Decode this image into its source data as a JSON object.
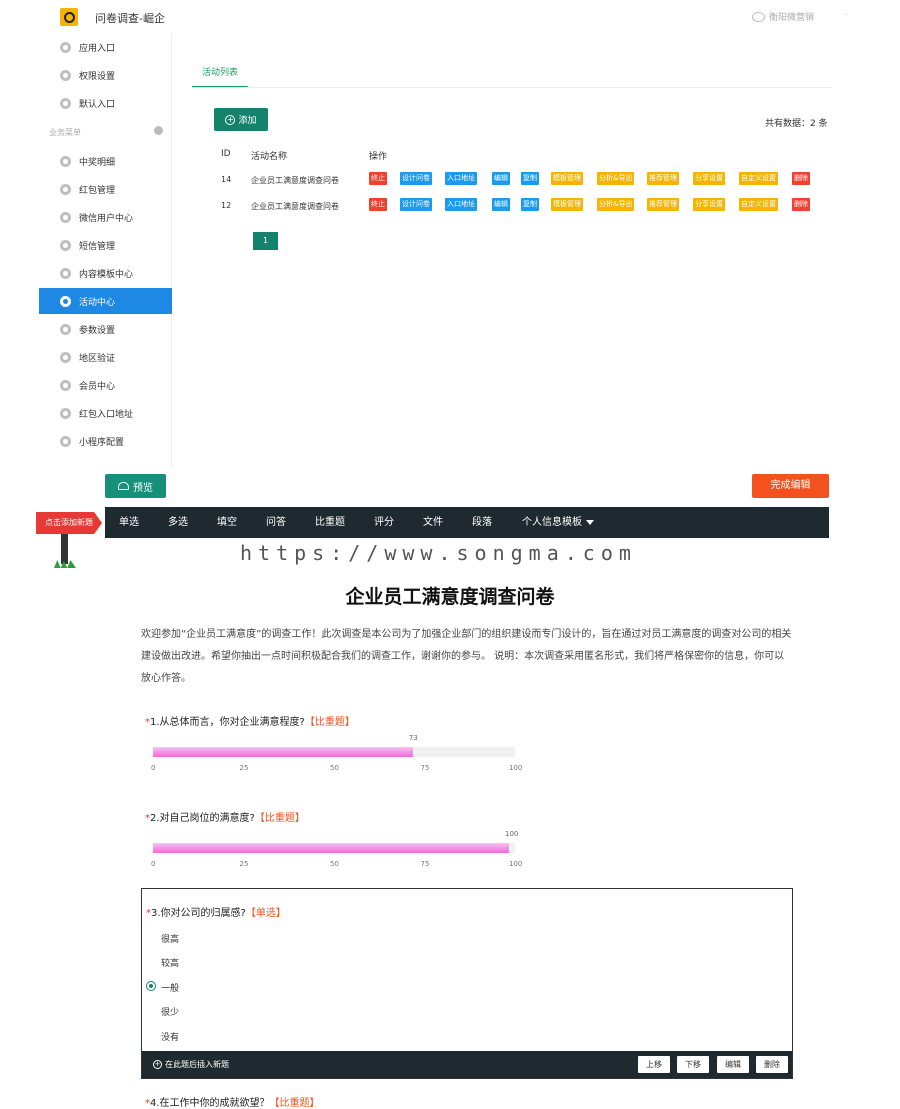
{
  "admin": {
    "app_title": "问卷调查-崛企",
    "account_name": "衡阳微营销",
    "sidebar": {
      "top_items": [
        {
          "label": "应用入口"
        },
        {
          "label": "权限设置"
        },
        {
          "label": "默认入口"
        }
      ],
      "section_label": "业务菜单",
      "items": [
        {
          "label": "中奖明细"
        },
        {
          "label": "红包管理"
        },
        {
          "label": "微信用户中心"
        },
        {
          "label": "短信管理"
        },
        {
          "label": "内容模板中心"
        },
        {
          "label": "活动中心"
        },
        {
          "label": "参数设置"
        },
        {
          "label": "地区验证"
        },
        {
          "label": "会员中心"
        },
        {
          "label": "红包入口地址"
        },
        {
          "label": "小程序配置"
        }
      ]
    },
    "tab_label": "活动列表",
    "add_button": "添加",
    "total_text": "共有数据：2 条",
    "table": {
      "headers": [
        "ID",
        "活动名称",
        "操作"
      ],
      "operations": [
        "终止",
        "设计问卷",
        "入口地址",
        "编辑",
        "复制",
        "模板管理",
        "分析&导出",
        "推荐管理",
        "分享设置",
        "自定义设置",
        "删除"
      ],
      "rows": [
        {
          "id": "14",
          "name": "企业员工满意度调查问卷"
        },
        {
          "id": "12",
          "name": "企业员工满意度调查问卷"
        }
      ]
    },
    "pager_current": "1"
  },
  "editor": {
    "preview_button": "预览",
    "finish_button": "完成编辑",
    "sign_label": "点击添加新题",
    "question_types": [
      "单选",
      "多选",
      "填空",
      "问答",
      "比重题",
      "评分",
      "文件",
      "段落",
      "个人信息模板"
    ],
    "watermark": "https://www.songma.com",
    "survey_title": "企业员工满意度调查问卷",
    "survey_intro": "欢迎参加“企业员工满意度”的调查工作！此次调查是本公司为了加强企业部门的组织建设而专门设计的，旨在通过对员工满意度的调查对公司的相关建设做出改进。希望你抽出一点时间积极配合我们的调查工作，谢谢你的参与。 说明：本次调查采用匿名形式，我们将严格保密你的信息，你可以放心作答。",
    "questions": [
      {
        "num": "*",
        "text": "1.从总体而言，你对企业满意程度?",
        "tag": "【比重题】",
        "value": 73,
        "ticks": [
          "0",
          "25",
          "50",
          "75",
          "100"
        ]
      },
      {
        "num": "*",
        "text": "2.对自己岗位的满意度?",
        "tag": "【比重题】",
        "value": 100,
        "ticks": [
          "0",
          "25",
          "50",
          "75",
          "100"
        ]
      },
      {
        "num": "*",
        "text": "3.你对公司的归属感?",
        "tag": "【单选】",
        "options": [
          "很高",
          "较高",
          "一般",
          "很少",
          "没有"
        ],
        "selected": "一般"
      },
      {
        "num": "*",
        "text": "4.在工作中你的成就欲望？",
        "tag": "【比重题】"
      }
    ],
    "q3_toolbar": {
      "insert_label": "在此题后插入新题",
      "buttons": [
        "上移",
        "下移",
        "编辑",
        "删除"
      ]
    }
  }
}
